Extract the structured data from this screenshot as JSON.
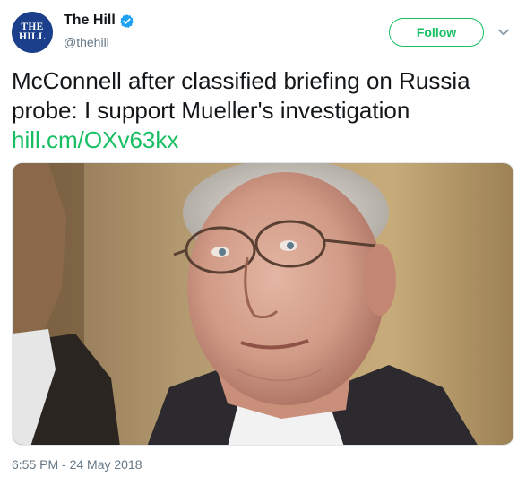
{
  "header": {
    "avatar_text": [
      "THE",
      "HILL"
    ],
    "display_name": "The Hill",
    "handle": "@thehill",
    "follow_label": "Follow",
    "verified_icon": "verified-badge-icon",
    "menu_icon": "chevron-down-icon"
  },
  "tweet": {
    "text": "McConnell after classified briefing on Russia probe: I support Mueller's investigation",
    "link_text": "hill.cm/OXv63kx",
    "timestamp": "6:55 PM - 24 May 2018"
  },
  "media": {
    "description": "photo-of-man-with-glasses"
  },
  "colors": {
    "accent_green": "#17bf63",
    "verified_blue": "#1da1f2",
    "avatar_bg": "#1b3f8b",
    "secondary_text": "#657786"
  }
}
